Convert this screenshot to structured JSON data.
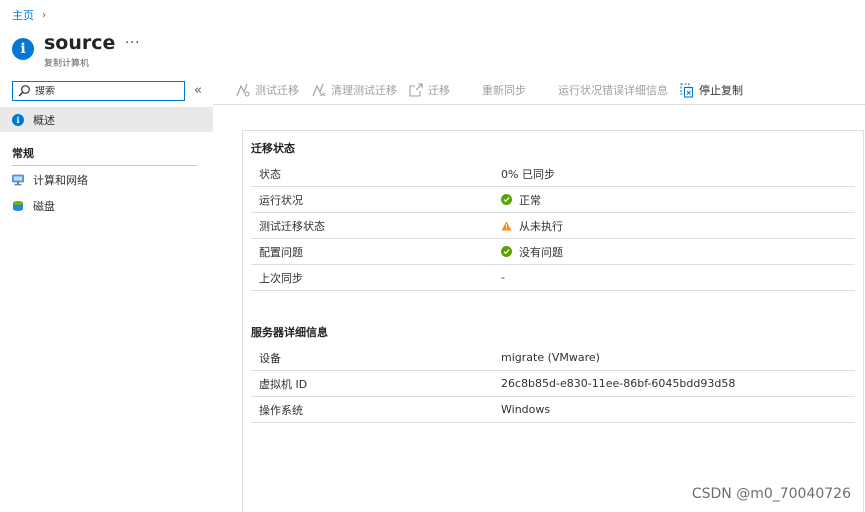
{
  "breadcrumb": {
    "home": "主页"
  },
  "header": {
    "title": "source",
    "subtitle": "复制计算机",
    "more": "···"
  },
  "sidebar": {
    "search_placeholder": "搜索",
    "collapse": "«",
    "selected_item": {
      "label": "概述",
      "icon": "info-icon"
    },
    "section_title": "常规",
    "items": [
      {
        "label": "计算和网络",
        "icon": "compute-network-icon"
      },
      {
        "label": "磁盘",
        "icon": "disk-icon"
      }
    ]
  },
  "toolbar": {
    "test_migrate": "测试迁移",
    "cleanup_test_migrate": "清理测试迁移",
    "migrate": "迁移",
    "resync": "重新同步",
    "health_errors": "运行状况错误详细信息",
    "stop_replication": "停止复制"
  },
  "migration_status": {
    "title": "迁移状态",
    "rows": [
      {
        "key": "状态",
        "value": "0% 已同步",
        "status": "none"
      },
      {
        "key": "运行状况",
        "value": "正常",
        "status": "ok"
      },
      {
        "key": "测试迁移状态",
        "value": "从未执行",
        "status": "warning"
      },
      {
        "key": "配置问题",
        "value": "没有问题",
        "status": "ok"
      },
      {
        "key": "上次同步",
        "value": "-",
        "status": "none"
      }
    ]
  },
  "server_details": {
    "title": "服务器详细信息",
    "rows": [
      {
        "key": "设备",
        "value": "migrate (VMware)"
      },
      {
        "key": "虚拟机 ID",
        "value": "26c8b85d-e830-11ee-86bf-6045bdd93d58"
      },
      {
        "key": "操作系统",
        "value": "Windows"
      }
    ]
  },
  "watermark": "CSDN @m0_70040726",
  "colors": {
    "accent": "#0078d4",
    "ok": "#57a300",
    "warning": "#ff8c00",
    "disabled": "#a19f9d"
  }
}
